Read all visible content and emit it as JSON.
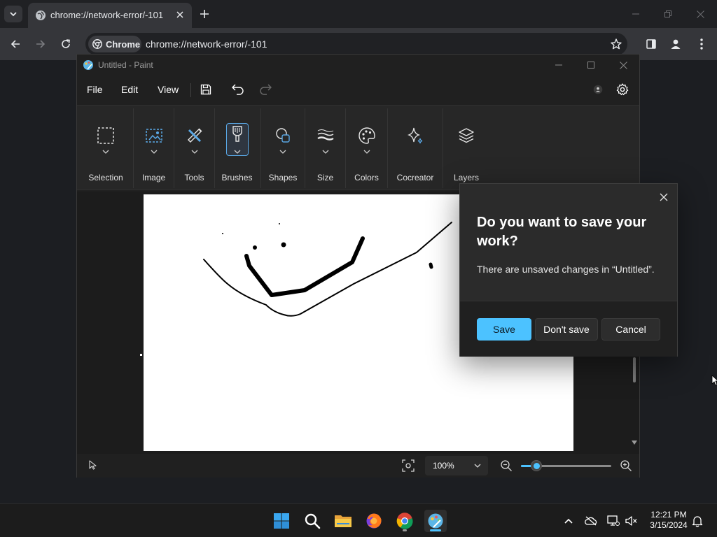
{
  "browser": {
    "tab_title": "chrome://network-error/-101",
    "origin_chip": "Chrome",
    "url": "chrome://network-error/-101"
  },
  "paint": {
    "window_title": "Untitled - Paint",
    "menu": {
      "file": "File",
      "edit": "Edit",
      "view": "View"
    },
    "ribbon": {
      "selection": "Selection",
      "image": "Image",
      "tools": "Tools",
      "brushes": "Brushes",
      "shapes": "Shapes",
      "size": "Size",
      "colors": "Colors",
      "cocreator": "Cocreator",
      "layers": "Layers"
    },
    "status": {
      "zoom": "100%",
      "zoom_slider_percent": 17
    }
  },
  "dialog": {
    "title": "Do you want to save your work?",
    "message": "There are unsaved changes in “Untitled”.",
    "save": "Save",
    "dont_save": "Don't save",
    "cancel": "Cancel"
  },
  "taskbar": {
    "time": "12:21 PM",
    "date": "3/15/2024"
  },
  "colors": {
    "accent": "#4cc2ff",
    "chrome_toolbar": "#35363a",
    "paint_bg": "#202020"
  },
  "icons": [
    "tab-search-icon",
    "globe-icon",
    "close-icon",
    "plus-icon",
    "minimize-icon",
    "maximize-icon",
    "back-icon",
    "forward-icon",
    "reload-icon",
    "chrome-icon",
    "star-icon",
    "sidebar-icon",
    "profile-icon",
    "menu-dots-icon",
    "paint-icon",
    "save-icon",
    "undo-icon",
    "redo-icon",
    "account-icon",
    "gear-icon",
    "selection-icon",
    "image-icon",
    "tools-icon",
    "brush-icon",
    "shapes-icon",
    "size-icon",
    "palette-icon",
    "sparkle-icon",
    "layers-icon",
    "chevron-down-icon",
    "cursor-icon",
    "fit-to-window-icon",
    "zoom-out-icon",
    "zoom-in-icon",
    "windows-start-icon",
    "search-icon",
    "file-explorer-icon",
    "firefox-icon",
    "chrome-icon",
    "chevron-up-icon",
    "onedrive-icon",
    "network-icon",
    "volume-icon",
    "bell-icon"
  ]
}
